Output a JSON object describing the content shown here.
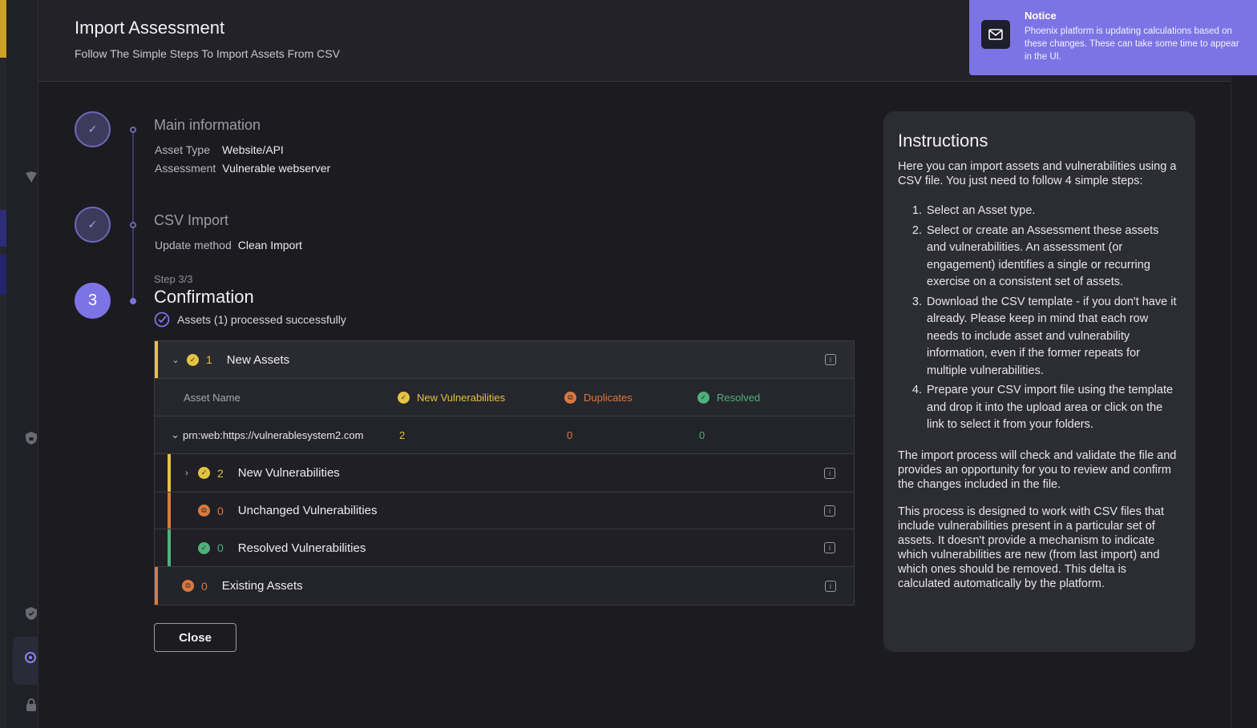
{
  "modal": {
    "title": "Import Assessment",
    "subtitle": "Follow The Simple Steps To Import Assets From CSV"
  },
  "steps": {
    "step1": {
      "title": "Main information",
      "asset_type_label": "Asset Type",
      "asset_type_value": "Website/API",
      "assessment_label": "Assessment",
      "assessment_value": "Vulnerable webserver"
    },
    "step2": {
      "title": "CSV Import",
      "update_method_label": "Update method",
      "update_method_value": "Clean Import"
    },
    "step3": {
      "number": "3",
      "counter": "Step 3/3",
      "title": "Confirmation",
      "success": "Assets (1) processed successfully"
    }
  },
  "results": {
    "new_assets": {
      "count": "1",
      "label": "New Assets"
    },
    "columns": {
      "asset_name": "Asset Name",
      "new_vulns": "New Vulnerabilities",
      "duplicates": "Duplicates",
      "resolved": "Resolved"
    },
    "asset_row": {
      "name": "prn:web:https://vulnerablesystem2.com",
      "new_vulns": "2",
      "duplicates": "0",
      "resolved": "0"
    },
    "new_vulnerabilities": {
      "count": "2",
      "label": "New Vulnerabilities"
    },
    "unchanged_vulnerabilities": {
      "count": "0",
      "label": "Unchanged Vulnerabilities"
    },
    "resolved_vulnerabilities": {
      "count": "0",
      "label": "Resolved Vulnerabilities"
    },
    "existing_assets": {
      "count": "0",
      "label": "Existing Assets"
    }
  },
  "close_label": "Close",
  "instructions": {
    "title": "Instructions",
    "intro": "Here you can import assets and vulnerabilities using a CSV file. You just need to follow 4 simple steps:",
    "steps": [
      {
        "n": "1.",
        "text": "Select an Asset type."
      },
      {
        "n": "2.",
        "text": "Select or create an Assessment these assets and vulnerabilities. An assessment (or engagement) identifies a single or recurring exercise on a consistent set of assets."
      },
      {
        "n": "3.",
        "text": "Download the CSV template - if you don't have it already. Please keep in mind that each row needs to include asset and vulnerability information, even if the former repeats for multiple vulnerabilities."
      },
      {
        "n": "4.",
        "text": "Prepare your CSV import file using the template and drop it into the upload area or click on the link to select it from your folders."
      }
    ],
    "para2": "The import process will check and validate the file and provides an opportunity for you to review and confirm the changes included in the file.",
    "para3": "This process is designed to work with CSV files that include vulnerabilities present in a particular set of assets. It doesn't provide a mechanism to indicate which vulnerabilities are new (from last import) and which ones should be removed. This delta is calculated automatically by the platform."
  },
  "notice": {
    "title": "Notice",
    "body": "Phoenix platform is updating calculations based on these changes. These can take some time to appear in the UI.",
    "icon": "mail-icon"
  },
  "colors": {
    "accent": "#7c74e4",
    "new": "#e3c342",
    "duplicate": "#d97a40",
    "resolved": "#4fb07a"
  }
}
